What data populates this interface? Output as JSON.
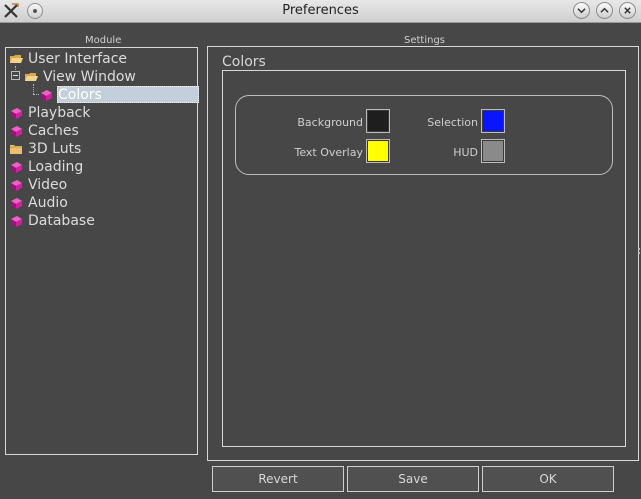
{
  "window": {
    "title": "Preferences"
  },
  "headers": {
    "module": "Module",
    "settings": "Settings"
  },
  "tree": {
    "items": [
      {
        "label": "User Interface",
        "icon": "folder-open-icon"
      },
      {
        "label": "View Window",
        "icon": "folder-open-icon"
      },
      {
        "label": "Colors",
        "icon": "book-icon",
        "selected": true
      },
      {
        "label": "Playback",
        "icon": "book-icon"
      },
      {
        "label": "Caches",
        "icon": "book-icon"
      },
      {
        "label": "3D Luts",
        "icon": "folder-icon"
      },
      {
        "label": "Loading",
        "icon": "book-icon"
      },
      {
        "label": "Video",
        "icon": "book-icon"
      },
      {
        "label": "Audio",
        "icon": "book-icon"
      },
      {
        "label": "Database",
        "icon": "book-icon"
      }
    ]
  },
  "colors": {
    "title": "Colors",
    "fields": [
      {
        "label": "Background",
        "color": "#1e1e1e"
      },
      {
        "label": "Selection",
        "color": "#0a14ff"
      },
      {
        "label": "Text Overlay",
        "color": "#ffff00"
      },
      {
        "label": "HUD",
        "color": "#8a8a8a"
      }
    ]
  },
  "buttons": {
    "revert": "Revert",
    "save": "Save",
    "ok": "OK"
  },
  "theme": {
    "background": "#474747",
    "book": "#d020a0",
    "folder": "#e8c070"
  }
}
